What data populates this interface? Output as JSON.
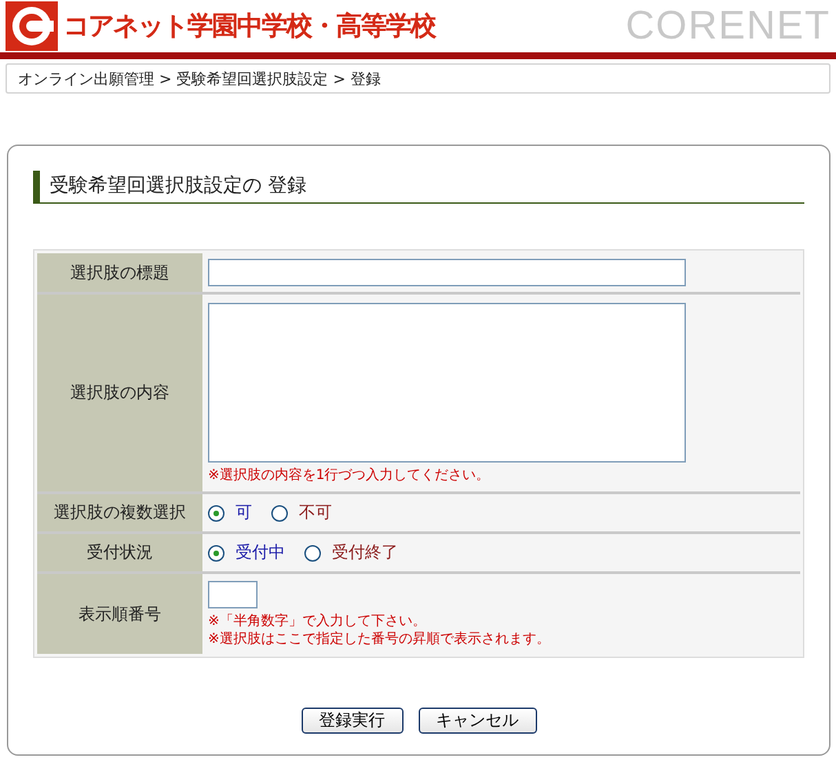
{
  "header": {
    "school_name": "コアネット学園中学校・高等学校",
    "brand": "CORENET"
  },
  "breadcrumb": "オンライン出願管理 > 受験希望回選択肢設定 > 登録",
  "section_title": "受験希望回選択肢設定の 登録",
  "form": [
    {
      "kind": "text",
      "label": "選択肢の標題"
    },
    {
      "kind": "textarea",
      "label": "選択肢の内容",
      "notes": [
        "※選択肢の内容を1行づつ入力してください。"
      ]
    },
    {
      "kind": "radio",
      "label": "選択肢の複数選択",
      "options": [
        {
          "label": "可",
          "selected": true
        },
        {
          "label": "不可",
          "selected": false
        }
      ]
    },
    {
      "kind": "radio",
      "label": "受付状況",
      "options": [
        {
          "label": "受付中",
          "selected": true
        },
        {
          "label": "受付終了",
          "selected": false
        }
      ]
    },
    {
      "kind": "number",
      "label": "表示順番号",
      "notes": [
        "※「半角数字」で入力して下さい。",
        "※選択肢はここで指定した番号の昇順で表示されます。"
      ]
    }
  ],
  "buttons": [
    "登録実行",
    "キャンセル"
  ]
}
